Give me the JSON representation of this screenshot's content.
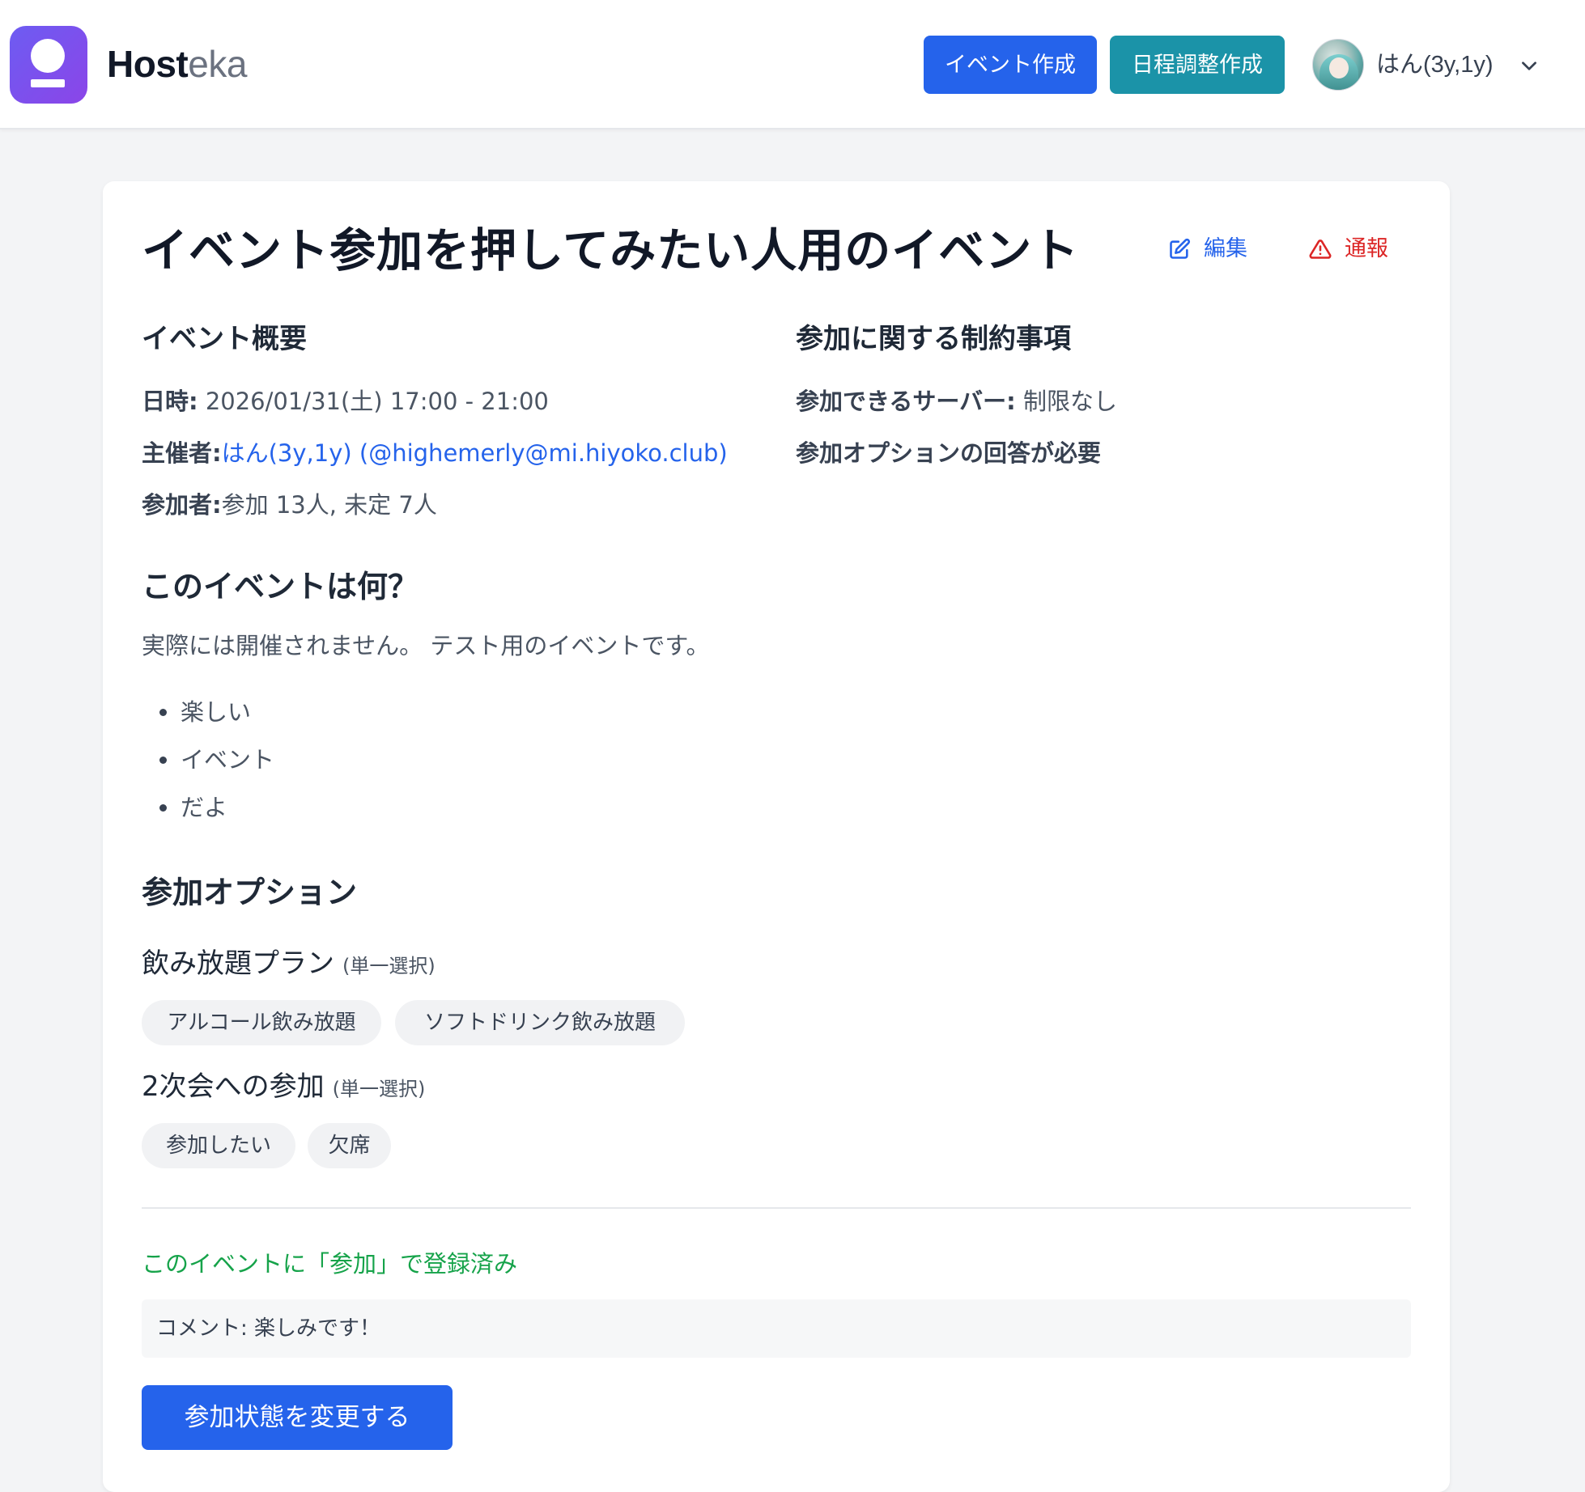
{
  "header": {
    "brand_bold": "Host",
    "brand_light": "eka",
    "create_event_label": "イベント作成",
    "create_schedule_label": "日程調整作成",
    "username": "はん(3y,1y)",
    "accent_color": "#2563eb",
    "schedule_color": "#1b93a8"
  },
  "event": {
    "title": "イベント参加を押してみたい人用のイベント",
    "edit_label": "編集",
    "report_label": "通報",
    "overview": {
      "heading": "イベント概要",
      "datetime_key": "日時:",
      "datetime_value": " 2026/01/31(土) 17:00 - 21:00",
      "organizer_key": "主催者:",
      "organizer_value": "はん(3y,1y) (@highemerly@mi.hiyoko.club)",
      "participants_key": "参加者:",
      "participants_value": "参加 13人, 未定 7人"
    },
    "constraints": {
      "heading": "参加に関する制約事項",
      "server_key": "参加できるサーバー:",
      "server_value": " 制限なし",
      "options_required": "参加オプションの回答が必要"
    },
    "about": {
      "heading": "このイベントは何？",
      "description": "実際には開催されません。 テスト用のイベントです。",
      "bullets": [
        "楽しい",
        "イベント",
        "だよ"
      ]
    },
    "options": {
      "heading": "参加オプション",
      "groups": [
        {
          "title": "飲み放題プラン",
          "note": "(単一選択)",
          "choices": [
            "アルコール飲み放題",
            "ソフトドリンク飲み放題"
          ]
        },
        {
          "title": "2次会への参加",
          "note": "(単一選択)",
          "choices": [
            "参加したい",
            "欠席"
          ]
        }
      ]
    },
    "status": "このイベントに「参加」で登録済み",
    "comment": "コメント: 楽しみです！",
    "change_button_label": "参加状態を変更する"
  },
  "icons": [
    "logo-icon",
    "avatar",
    "chevron-down-icon",
    "edit-icon",
    "warning-icon"
  ]
}
